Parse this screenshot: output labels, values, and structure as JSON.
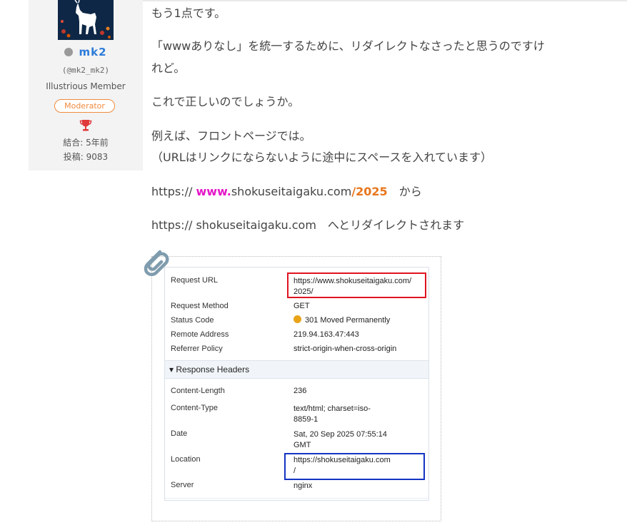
{
  "profile": {
    "name": "mk2",
    "handle": "(@mk2_mk2)",
    "rank": "Illustrious Member",
    "badge": "Moderator",
    "joined": "結合: 5年前",
    "posts": "投稿: 9083",
    "status_color": "#9a9a9a",
    "icons": [
      "avatar-deer",
      "status-dot-icon",
      "trophy-icon"
    ]
  },
  "post": {
    "lines": [
      "もう1点です。",
      "「wwwありなし」を統一するために、リダイレクトなさったと思うのですけ",
      "れど。",
      "これで正しいのでしょうか。",
      "例えば、フロントページでは。",
      "（URLはリンクにならないように途中にスペースを入れています）"
    ],
    "url_line": {
      "prefix": "https:// ",
      "www": "www.",
      "domain": "shokuseitaigaku.com",
      "slash": "/",
      "path": "2025",
      "suffix": "　から"
    },
    "redirect_line": "https:// shokuseitaigaku.com　へとリダイレクトされます",
    "accent_colors": {
      "www": "#e418c8",
      "path": "#e8761c"
    }
  },
  "attachment": {
    "icon": "paperclip-icon",
    "general": [
      {
        "label": "Request URL",
        "value": "https://www.shokuseitaigaku.com/\n2025/"
      },
      {
        "label": "Request Method",
        "value": "GET"
      },
      {
        "label": "Status Code",
        "value": "301 Moved Permanently"
      },
      {
        "label": "Remote Address",
        "value": "219.94.163.47:443"
      },
      {
        "label": "Referrer Policy",
        "value": "strict-origin-when-cross-origin"
      }
    ],
    "section_title": "▾ Response Headers",
    "headers": [
      {
        "label": "Content-Length",
        "value": "236"
      },
      {
        "label": "Content-Type",
        "value": "text/html; charset=iso-\n8859-1"
      },
      {
        "label": "Date",
        "value": "Sat, 20 Sep 2025 07:55:14\nGMT"
      },
      {
        "label": "Location",
        "value": "https://shokuseitaigaku.com\n/"
      },
      {
        "label": "Server",
        "value": "nginx"
      }
    ],
    "highlight_colors": {
      "request_url": "#e0131f",
      "location": "#1433c4"
    }
  }
}
